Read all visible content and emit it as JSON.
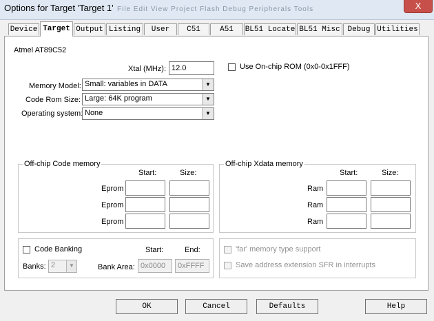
{
  "window": {
    "title": "Options for Target 'Target 1'",
    "bg_menu": "File  Edit  View  Project  Flash  Debug  Peripherals  Tools",
    "close_glyph": "X"
  },
  "tabs": [
    "Device",
    "Target",
    "Output",
    "Listing",
    "User",
    "C51",
    "A51",
    "BL51 Locate",
    "BL51 Misc",
    "Debug",
    "Utilities"
  ],
  "active_tab": "Target",
  "device_name": "Atmel AT89C52",
  "xtal": {
    "label": "Xtal (MHz):",
    "value": "12.0"
  },
  "onchip_rom": {
    "label": "Use On-chip ROM (0x0-0x1FFF)",
    "checked": false
  },
  "memory_model": {
    "label": "Memory Model:",
    "value": "Small: variables in DATA"
  },
  "code_rom_size": {
    "label": "Code Rom Size:",
    "value": "Large: 64K program"
  },
  "operating_system": {
    "label": "Operating system:",
    "value": "None"
  },
  "offchip_code": {
    "title": "Off-chip Code memory",
    "start_header": "Start:",
    "size_header": "Size:",
    "rows": [
      {
        "label": "Eprom",
        "start": "",
        "size": ""
      },
      {
        "label": "Eprom",
        "start": "",
        "size": ""
      },
      {
        "label": "Eprom",
        "start": "",
        "size": ""
      }
    ]
  },
  "offchip_xdata": {
    "title": "Off-chip Xdata memory",
    "start_header": "Start:",
    "size_header": "Size:",
    "rows": [
      {
        "label": "Ram",
        "start": "",
        "size": ""
      },
      {
        "label": "Ram",
        "start": "",
        "size": ""
      },
      {
        "label": "Ram",
        "start": "",
        "size": ""
      }
    ]
  },
  "code_banking": {
    "label": "Code Banking",
    "checked": false,
    "banks_label": "Banks:",
    "banks_value": "2",
    "bank_area_label": "Bank Area:",
    "start_header": "Start:",
    "end_header": "End:",
    "start_value": "0x0000",
    "end_value": "0xFFFF"
  },
  "far_memory": {
    "label": "'far' memory type support",
    "checked": false
  },
  "save_sfr": {
    "label": "Save address extension SFR in interrupts",
    "checked": false
  },
  "buttons": {
    "ok": "OK",
    "cancel": "Cancel",
    "defaults": "Defaults",
    "help": "Help"
  },
  "icons": {
    "dropdown": "chevron-down-icon",
    "close": "close-icon"
  }
}
